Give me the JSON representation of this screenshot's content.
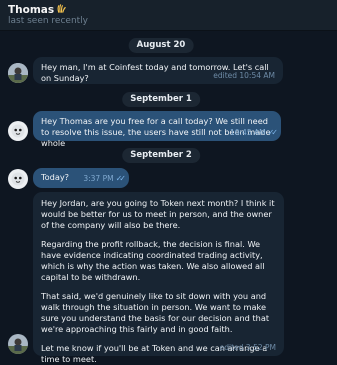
{
  "header": {
    "name": "Thomas",
    "emoji": "🫰",
    "status": "last seen recently"
  },
  "dates": {
    "aug20": "August 20",
    "sep1": "September 1",
    "sep2": "September 2"
  },
  "messages": {
    "m1": {
      "text": "Hey man, I'm at Coinfest today and tomorrow. Let's call on Sunday?",
      "meta": "edited 10:54 AM"
    },
    "m2": {
      "text": "Hey Thomas are you free for a call today? We still need to resolve this issue, the users have still not been made whole",
      "meta": "10:45 AM"
    },
    "m3": {
      "text": "Today?",
      "meta": "3:37 PM"
    },
    "m4": {
      "p1": "Hey Jordan, are you going to Token next month? I think it would be better for us to meet in person, and the owner of the company will also be there.",
      "p2": "Regarding the profit rollback, the decision is final. We have evidence indicating coordinated trading activity, which is why the action was taken. We also allowed all capital to be withdrawn.",
      "p3": "That said, we'd genuinely like to sit down with you and walk through the situation in person. We want to make sure you understand the basis for our decision and that we're approaching this fairly and in good faith.",
      "p4": "Let me know if you'll be at Token and we can arrange a time to meet.",
      "meta": "edited 3:52 PM"
    }
  },
  "colors": {
    "background": "#0e1621",
    "incoming_bubble": "#182533",
    "outgoing_bubble": "#2b5278",
    "read_check": "#7fb6ea"
  },
  "icons": {
    "read_receipt": "double-check-icon"
  }
}
